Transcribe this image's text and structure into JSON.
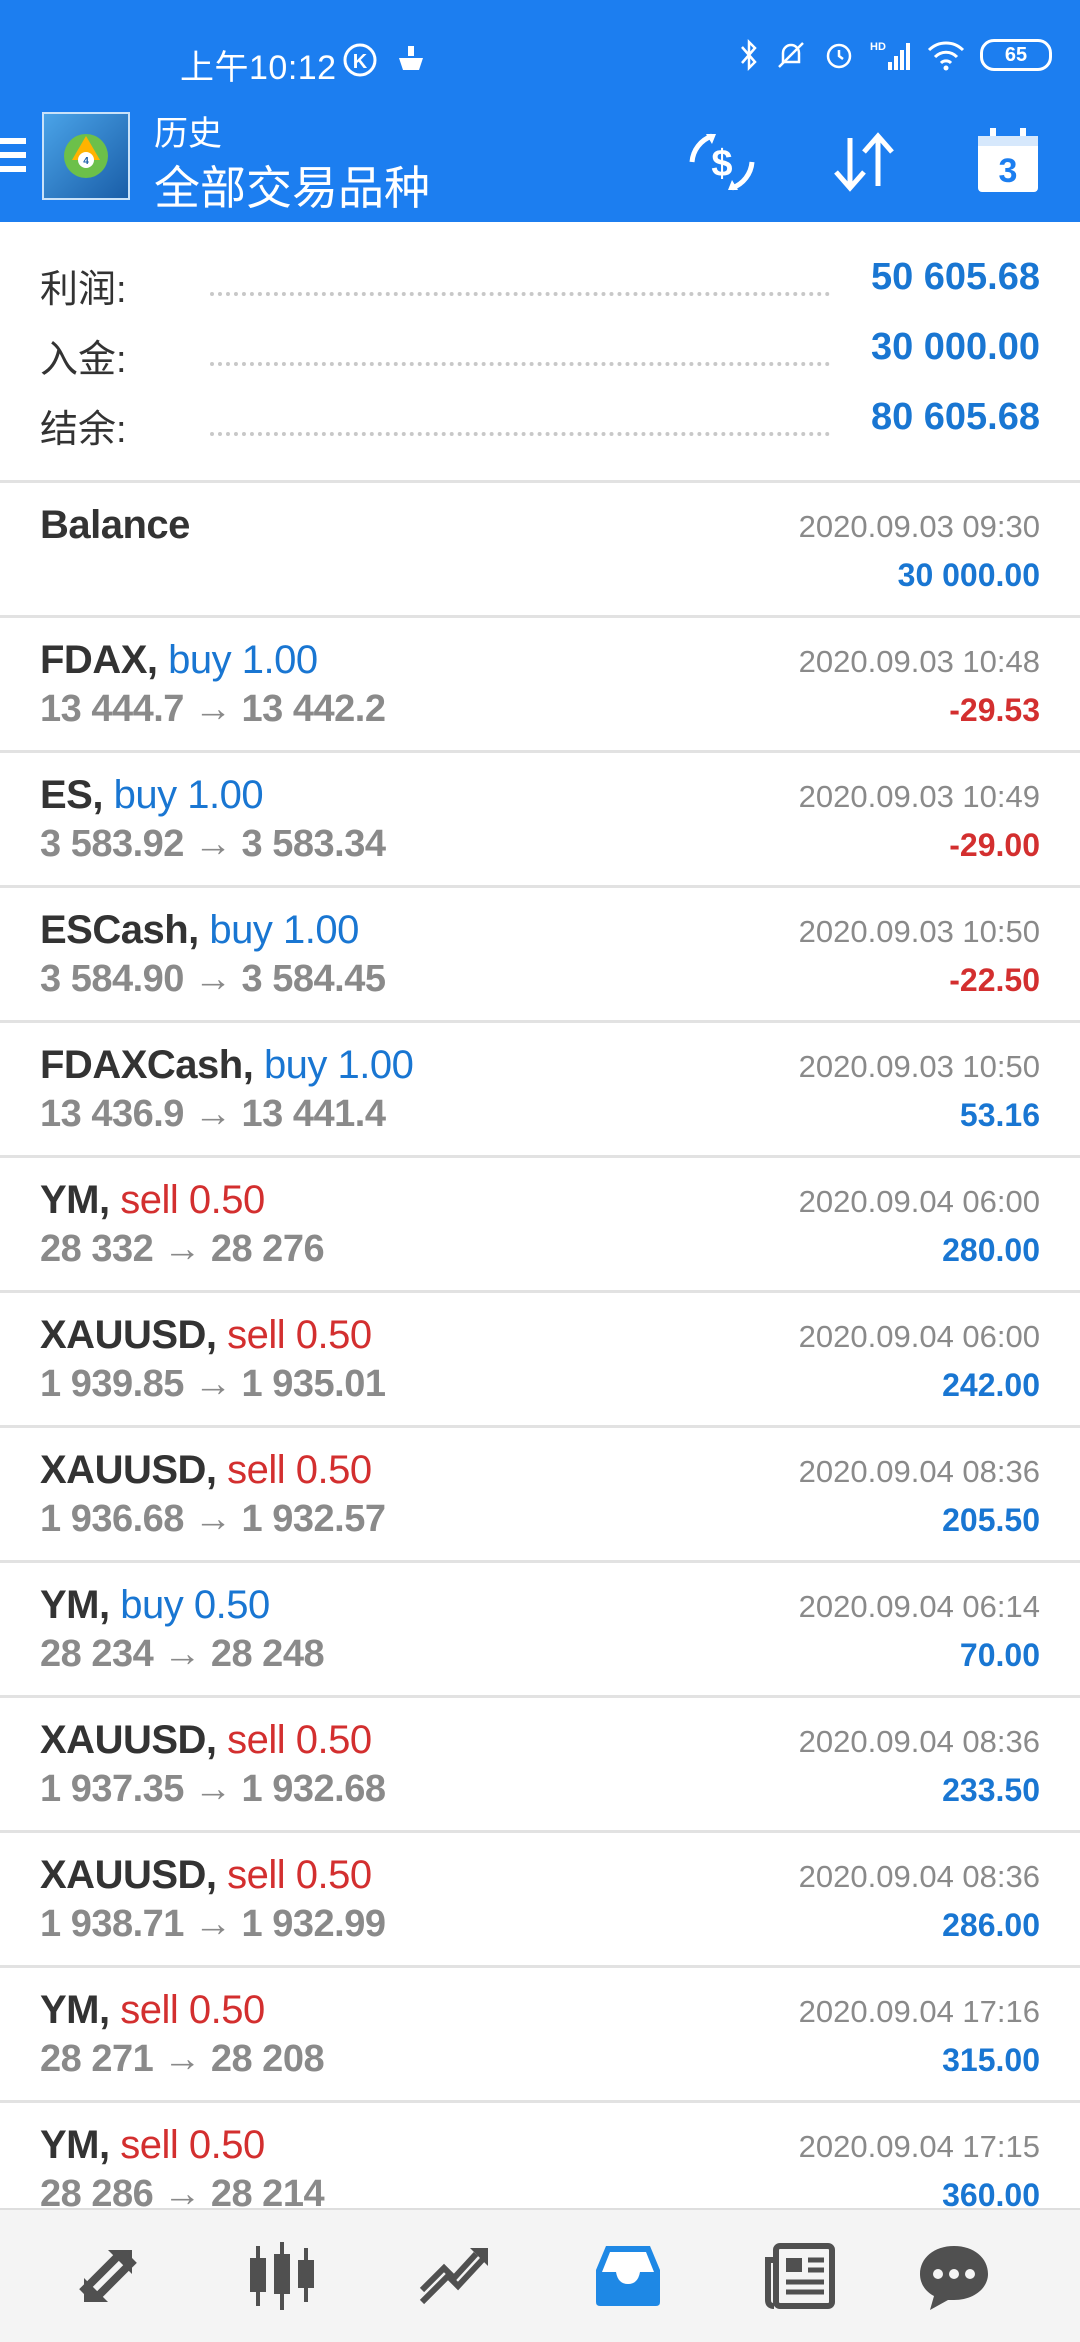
{
  "status_bar": {
    "time": "上午10:12",
    "battery": "65"
  },
  "header": {
    "subtitle": "历史",
    "title": "全部交易品种",
    "calendar_day": "3"
  },
  "summary": [
    {
      "label": "利润:",
      "value": "50 605.68"
    },
    {
      "label": "入金:",
      "value": "30 000.00"
    },
    {
      "label": "结余:",
      "value": "80 605.68"
    }
  ],
  "balance_entry": {
    "label": "Balance",
    "time": "2020.09.03 09:30",
    "amount": "30 000.00"
  },
  "deals": [
    {
      "symbol": "FDAX,",
      "side": "buy 1.00",
      "dir": "buy",
      "open": "13 444.7",
      "arrow": "→",
      "close": "13 442.2",
      "time": "2020.09.03 10:48",
      "profit": "-29.53",
      "sign": "neg"
    },
    {
      "symbol": "ES,",
      "side": "buy 1.00",
      "dir": "buy",
      "open": "3 583.92",
      "arrow": "→",
      "close": "3 583.34",
      "time": "2020.09.03 10:49",
      "profit": "-29.00",
      "sign": "neg"
    },
    {
      "symbol": "ESCash,",
      "side": "buy 1.00",
      "dir": "buy",
      "open": "3 584.90",
      "arrow": "→",
      "close": "3 584.45",
      "time": "2020.09.03 10:50",
      "profit": "-22.50",
      "sign": "neg"
    },
    {
      "symbol": "FDAXCash,",
      "side": "buy 1.00",
      "dir": "buy",
      "open": "13 436.9",
      "arrow": "→",
      "close": "13 441.4",
      "time": "2020.09.03 10:50",
      "profit": "53.16",
      "sign": "pos"
    },
    {
      "symbol": "YM,",
      "side": "sell 0.50",
      "dir": "sell",
      "open": "28 332",
      "arrow": "→",
      "close": "28 276",
      "time": "2020.09.04 06:00",
      "profit": "280.00",
      "sign": "pos"
    },
    {
      "symbol": "XAUUSD,",
      "side": "sell 0.50",
      "dir": "sell",
      "open": "1 939.85",
      "arrow": "→",
      "close": "1 935.01",
      "time": "2020.09.04 06:00",
      "profit": "242.00",
      "sign": "pos"
    },
    {
      "symbol": "XAUUSD,",
      "side": "sell 0.50",
      "dir": "sell",
      "open": "1 936.68",
      "arrow": "→",
      "close": "1 932.57",
      "time": "2020.09.04 08:36",
      "profit": "205.50",
      "sign": "pos"
    },
    {
      "symbol": "YM,",
      "side": "buy 0.50",
      "dir": "buy",
      "open": "28 234",
      "arrow": "→",
      "close": "28 248",
      "time": "2020.09.04 06:14",
      "profit": "70.00",
      "sign": "pos"
    },
    {
      "symbol": "XAUUSD,",
      "side": "sell 0.50",
      "dir": "sell",
      "open": "1 937.35",
      "arrow": "→",
      "close": "1 932.68",
      "time": "2020.09.04 08:36",
      "profit": "233.50",
      "sign": "pos"
    },
    {
      "symbol": "XAUUSD,",
      "side": "sell 0.50",
      "dir": "sell",
      "open": "1 938.71",
      "arrow": "→",
      "close": "1 932.99",
      "time": "2020.09.04 08:36",
      "profit": "286.00",
      "sign": "pos"
    },
    {
      "symbol": "YM,",
      "side": "sell 0.50",
      "dir": "sell",
      "open": "28 271",
      "arrow": "→",
      "close": "28 208",
      "time": "2020.09.04 17:16",
      "profit": "315.00",
      "sign": "pos"
    },
    {
      "symbol": "YM,",
      "side": "sell 0.50",
      "dir": "sell",
      "open": "28 286",
      "arrow": "→",
      "close": "28 214",
      "time": "2020.09.04 17:15",
      "profit": "360.00",
      "sign": "pos"
    }
  ],
  "colors": {
    "header_bg": "#1c7ef0",
    "buy": "#1976d2",
    "sell": "#d32f2f",
    "nav_active": "#1e88e5",
    "nav_inactive": "#505050"
  },
  "bottom_nav": [
    {
      "name": "quotes-tab",
      "icon": "arrows-icon",
      "active": false
    },
    {
      "name": "chart-tab",
      "icon": "candlestick-icon",
      "active": false
    },
    {
      "name": "trade-tab",
      "icon": "trend-icon",
      "active": false
    },
    {
      "name": "history-tab",
      "icon": "inbox-icon",
      "active": true
    },
    {
      "name": "news-tab",
      "icon": "newspaper-icon",
      "active": false
    },
    {
      "name": "chat-tab",
      "icon": "chat-bubble-icon",
      "active": false
    }
  ]
}
